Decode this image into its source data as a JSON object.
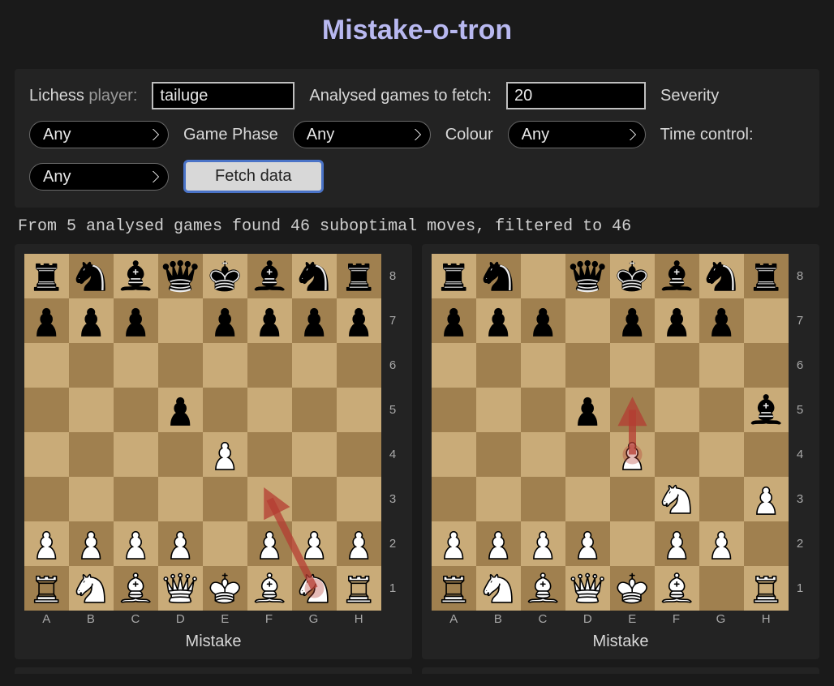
{
  "title": "Mistake-o-tron",
  "controls": {
    "player_label_main": "Lichess",
    "player_label_sub": " player:",
    "player_value": "tailuge",
    "games_label": "Analysed games to fetch:",
    "games_value": "20",
    "severity_label": "Severity",
    "severity_selected": "Any",
    "phase_label": "Game Phase",
    "phase_selected": "Any",
    "colour_label": "Colour",
    "colour_selected": "Any",
    "time_label": "Time control:",
    "time_selected": "Any",
    "fetch_label": "Fetch data"
  },
  "status_text": "From 5 analysed games found 46 suboptimal moves, filtered to 46",
  "files": [
    "A",
    "B",
    "C",
    "D",
    "E",
    "F",
    "G",
    "H"
  ],
  "ranks": [
    "8",
    "7",
    "6",
    "5",
    "4",
    "3",
    "2",
    "1"
  ],
  "boards": [
    {
      "caption": "Mistake",
      "pieces": [
        {
          "sq": "a8",
          "p": "r",
          "c": "b"
        },
        {
          "sq": "b8",
          "p": "n",
          "c": "b"
        },
        {
          "sq": "c8",
          "p": "b",
          "c": "b"
        },
        {
          "sq": "d8",
          "p": "q",
          "c": "b"
        },
        {
          "sq": "e8",
          "p": "k",
          "c": "b"
        },
        {
          "sq": "f8",
          "p": "b",
          "c": "b"
        },
        {
          "sq": "g8",
          "p": "n",
          "c": "b"
        },
        {
          "sq": "h8",
          "p": "r",
          "c": "b"
        },
        {
          "sq": "a7",
          "p": "p",
          "c": "b"
        },
        {
          "sq": "b7",
          "p": "p",
          "c": "b"
        },
        {
          "sq": "c7",
          "p": "p",
          "c": "b"
        },
        {
          "sq": "e7",
          "p": "p",
          "c": "b"
        },
        {
          "sq": "f7",
          "p": "p",
          "c": "b"
        },
        {
          "sq": "g7",
          "p": "p",
          "c": "b"
        },
        {
          "sq": "h7",
          "p": "p",
          "c": "b"
        },
        {
          "sq": "d5",
          "p": "p",
          "c": "b"
        },
        {
          "sq": "e4",
          "p": "p",
          "c": "w"
        },
        {
          "sq": "a2",
          "p": "p",
          "c": "w"
        },
        {
          "sq": "b2",
          "p": "p",
          "c": "w"
        },
        {
          "sq": "c2",
          "p": "p",
          "c": "w"
        },
        {
          "sq": "d2",
          "p": "p",
          "c": "w"
        },
        {
          "sq": "f2",
          "p": "p",
          "c": "w"
        },
        {
          "sq": "g2",
          "p": "p",
          "c": "w"
        },
        {
          "sq": "h2",
          "p": "p",
          "c": "w"
        },
        {
          "sq": "a1",
          "p": "r",
          "c": "w"
        },
        {
          "sq": "b1",
          "p": "n",
          "c": "w"
        },
        {
          "sq": "c1",
          "p": "b",
          "c": "w"
        },
        {
          "sq": "d1",
          "p": "q",
          "c": "w"
        },
        {
          "sq": "e1",
          "p": "k",
          "c": "w"
        },
        {
          "sq": "f1",
          "p": "b",
          "c": "w"
        },
        {
          "sq": "g1",
          "p": "n",
          "c": "w"
        },
        {
          "sq": "h1",
          "p": "r",
          "c": "w"
        }
      ],
      "arrow": {
        "from": "g1",
        "to": "f3"
      }
    },
    {
      "caption": "Mistake",
      "pieces": [
        {
          "sq": "a8",
          "p": "r",
          "c": "b"
        },
        {
          "sq": "b8",
          "p": "n",
          "c": "b"
        },
        {
          "sq": "d8",
          "p": "q",
          "c": "b"
        },
        {
          "sq": "e8",
          "p": "k",
          "c": "b"
        },
        {
          "sq": "f8",
          "p": "b",
          "c": "b"
        },
        {
          "sq": "g8",
          "p": "n",
          "c": "b"
        },
        {
          "sq": "h8",
          "p": "r",
          "c": "b"
        },
        {
          "sq": "a7",
          "p": "p",
          "c": "b"
        },
        {
          "sq": "b7",
          "p": "p",
          "c": "b"
        },
        {
          "sq": "c7",
          "p": "p",
          "c": "b"
        },
        {
          "sq": "e7",
          "p": "p",
          "c": "b"
        },
        {
          "sq": "f7",
          "p": "p",
          "c": "b"
        },
        {
          "sq": "g7",
          "p": "p",
          "c": "b"
        },
        {
          "sq": "d5",
          "p": "p",
          "c": "b"
        },
        {
          "sq": "h5",
          "p": "b",
          "c": "b"
        },
        {
          "sq": "e4",
          "p": "p",
          "c": "w"
        },
        {
          "sq": "f3",
          "p": "n",
          "c": "w"
        },
        {
          "sq": "h3",
          "p": "p",
          "c": "w"
        },
        {
          "sq": "a2",
          "p": "p",
          "c": "w"
        },
        {
          "sq": "b2",
          "p": "p",
          "c": "w"
        },
        {
          "sq": "c2",
          "p": "p",
          "c": "w"
        },
        {
          "sq": "d2",
          "p": "p",
          "c": "w"
        },
        {
          "sq": "f2",
          "p": "p",
          "c": "w"
        },
        {
          "sq": "g2",
          "p": "p",
          "c": "w"
        },
        {
          "sq": "a1",
          "p": "r",
          "c": "w"
        },
        {
          "sq": "b1",
          "p": "n",
          "c": "w"
        },
        {
          "sq": "c1",
          "p": "b",
          "c": "w"
        },
        {
          "sq": "d1",
          "p": "q",
          "c": "w"
        },
        {
          "sq": "e1",
          "p": "k",
          "c": "w"
        },
        {
          "sq": "f1",
          "p": "b",
          "c": "w"
        },
        {
          "sq": "h1",
          "p": "r",
          "c": "w"
        }
      ],
      "arrow": {
        "from": "e4",
        "to": "e5"
      }
    }
  ]
}
